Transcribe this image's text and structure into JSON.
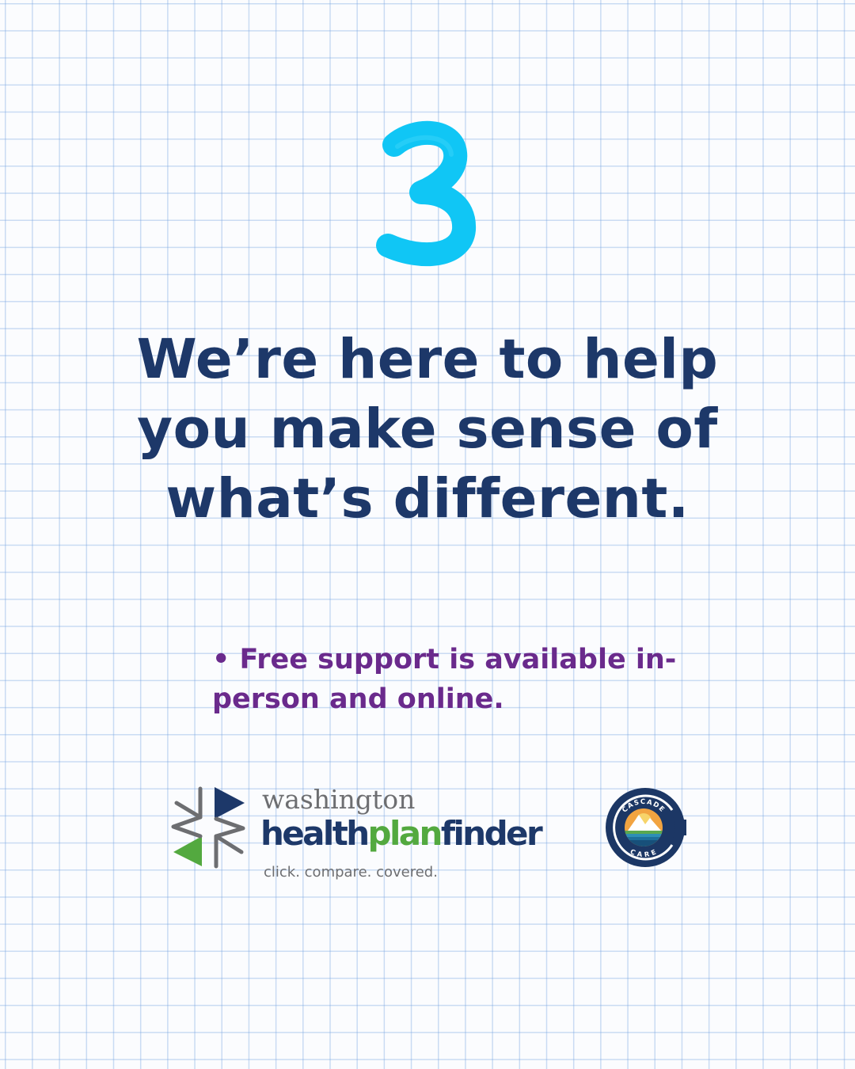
{
  "step_number": "3",
  "headline": "We’re here to help you make sense of what’s different.",
  "bullet": "• Free support is available in-person and online.",
  "logo_hpf": {
    "line1": "washington",
    "line2_part1": "health",
    "line2_part2": "plan",
    "line2_part3": "finder",
    "tagline": "click. compare. covered."
  },
  "logo_cascade": {
    "top_text": "CASCADE",
    "bottom_text": "CARE"
  },
  "colors": {
    "number": "#10c6f5",
    "headline": "#1d3869",
    "bullet": "#6a2a8c",
    "hpf_gray": "#6d6e71",
    "hpf_navy": "#1d3869",
    "hpf_green": "#53a93f",
    "cascade_navy": "#1c3765"
  }
}
